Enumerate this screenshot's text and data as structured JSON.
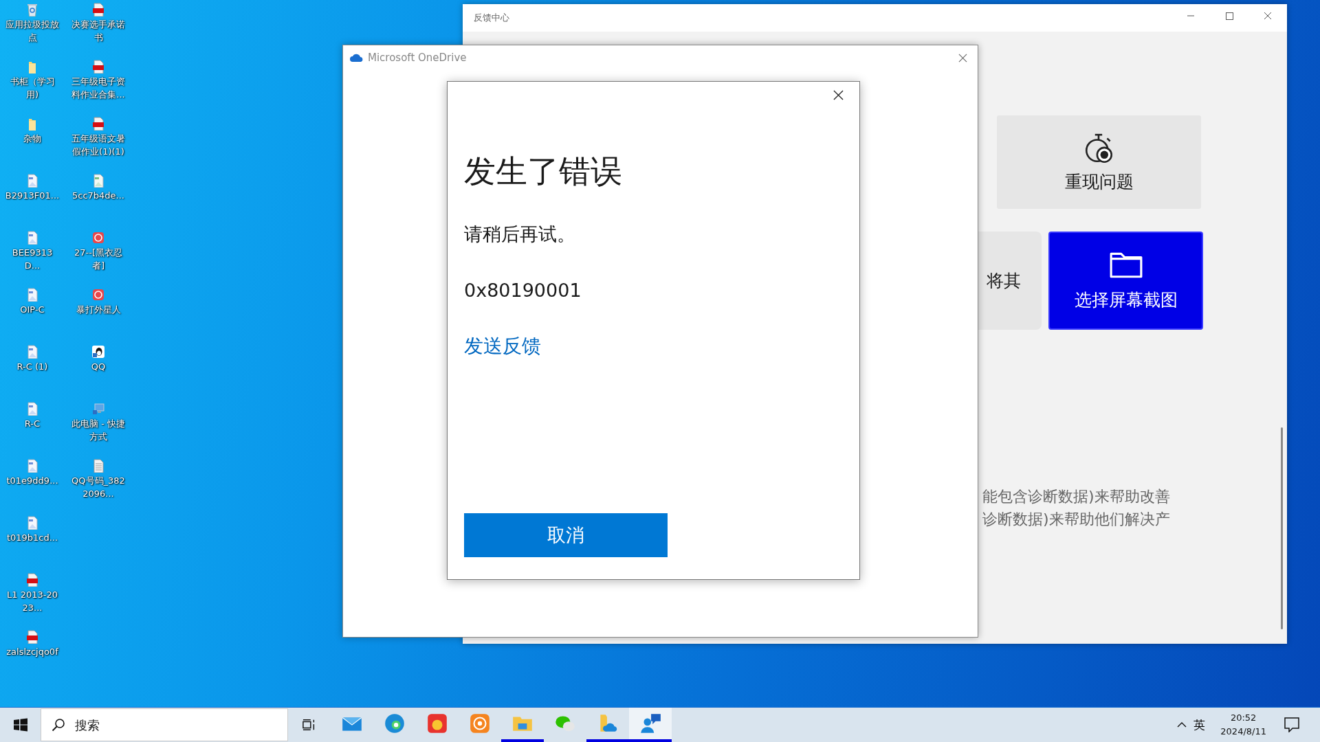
{
  "desktop_icons": [
    {
      "label": "应用拉圾投放点",
      "kind": "recycle"
    },
    {
      "label": "书柜（学习用)",
      "kind": "folder"
    },
    {
      "label": "杂物",
      "kind": "folder"
    },
    {
      "label": "B2913F01...",
      "kind": "image"
    },
    {
      "label": "BEE9313D...",
      "kind": "image"
    },
    {
      "label": "OIP-C",
      "kind": "image"
    },
    {
      "label": "R-C (1)",
      "kind": "image"
    },
    {
      "label": "R-C",
      "kind": "image"
    },
    {
      "label": "t01e9dd9...",
      "kind": "image"
    },
    {
      "label": "t019b1cd...",
      "kind": "image"
    },
    {
      "label": "L1 2013-2023...",
      "kind": "pdf"
    },
    {
      "label": "zalslzcjqo0f",
      "kind": "pdf"
    },
    {
      "label": "决赛选手承诺书",
      "kind": "pdf"
    },
    {
      "label": "三年级电子资料作业合集...",
      "kind": "pdf"
    },
    {
      "label": "五年级语文暑假作业(1)(1)",
      "kind": "pdf"
    },
    {
      "label": "5cc7b4de...",
      "kind": "png"
    },
    {
      "label": "27--[黑衣忍者]",
      "kind": "game"
    },
    {
      "label": "暴打外星人",
      "kind": "game"
    },
    {
      "label": "QQ",
      "kind": "qq"
    },
    {
      "label": "此电脑 - 快捷方式",
      "kind": "computer"
    },
    {
      "label": "QQ号码_3822096...",
      "kind": "text"
    }
  ],
  "feedback_window": {
    "title": "反馈中心",
    "reproduce_card": {
      "label": "重现问题"
    },
    "partial_card": {
      "label": "将其"
    },
    "screenshot_button": {
      "label": "选择屏幕截图"
    },
    "body_lines": [
      "能包含诊断数据)来帮助改善",
      "诊断数据)来帮助他们解决产"
    ]
  },
  "onedrive_window": {
    "title": "Microsoft OneDrive"
  },
  "error_dialog": {
    "title": "发生了错误",
    "message": "请稍后再试。",
    "code": "0x80190001",
    "link": "发送反馈",
    "button": "取消"
  },
  "taskbar": {
    "search": {
      "placeholder": "搜索"
    },
    "apps": [
      {
        "kind": "mail",
        "running": false,
        "selected": false
      },
      {
        "kind": "edge",
        "running": false,
        "selected": false
      },
      {
        "kind": "kid",
        "running": false,
        "selected": false
      },
      {
        "kind": "orange",
        "running": false,
        "selected": false
      },
      {
        "kind": "explorer",
        "running": true,
        "selected": false
      },
      {
        "kind": "wechat",
        "running": false,
        "selected": false
      },
      {
        "kind": "onedrive",
        "running": true,
        "selected": false
      },
      {
        "kind": "feedback",
        "running": true,
        "selected": true
      }
    ],
    "input_method": "英",
    "time": "20:52",
    "date": "2024/8/11"
  }
}
